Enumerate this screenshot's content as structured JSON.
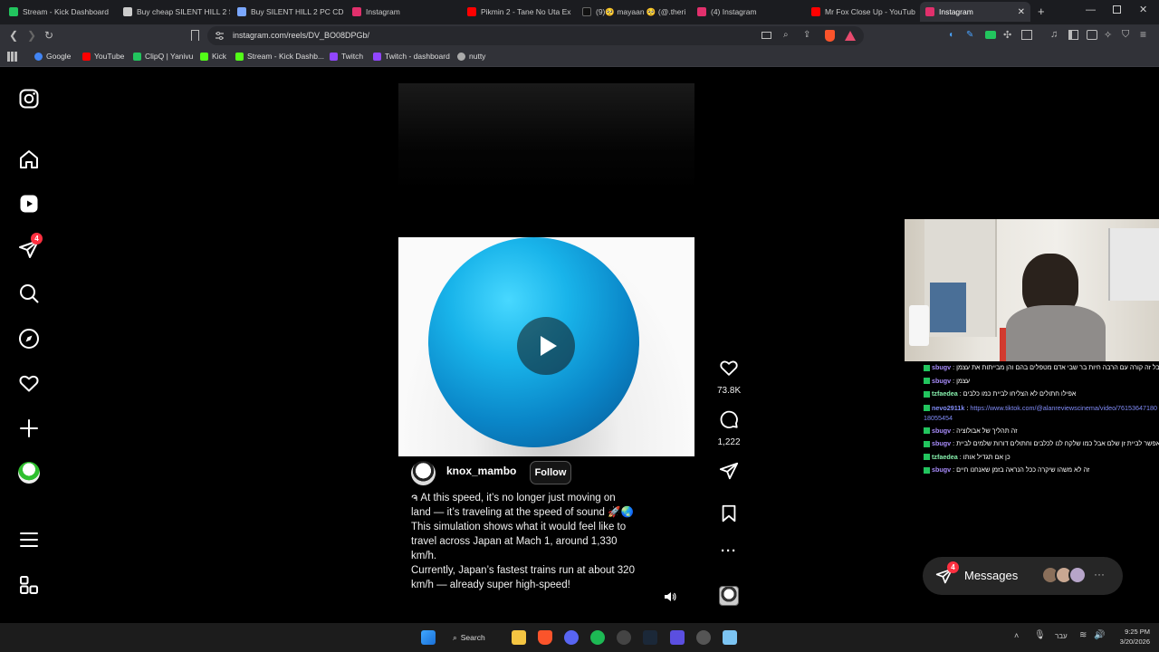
{
  "browser": {
    "tabs": [
      {
        "title": "Stream - Kick Dashboard",
        "fav": "#22c55e"
      },
      {
        "title": "Buy cheap SILENT HILL 2 S",
        "fav": "#cccccc"
      },
      {
        "title": "Buy SILENT HILL 2 PC CD K",
        "fav": "#7aa7ff"
      },
      {
        "title": "Instagram",
        "fav": "#e1306c"
      },
      {
        "title": "Pikmin 2 - Tane No Uta Ex",
        "fav": "#ff0000"
      },
      {
        "title": "(9)🥺 mayaan 🥺 (@.theri",
        "fav": "#111111"
      },
      {
        "title": "(4) Instagram",
        "fav": "#e1306c"
      },
      {
        "title": "Mr Fox Close Up - YouTub",
        "fav": "#ff0000"
      },
      {
        "title": "Instagram",
        "fav": "#e1306c"
      }
    ],
    "url": "instagram.com/reels/DV_BO08DPGb/",
    "bookmarks": [
      {
        "label": "Google",
        "color": "#4285f4"
      },
      {
        "label": "YouTube",
        "color": "#ff0000"
      },
      {
        "label": "ClipQ | Yanivu",
        "color": "#22c55e"
      },
      {
        "label": "Kick",
        "color": "#53fc18"
      },
      {
        "label": "Stream - Kick Dashb...",
        "color": "#53fc18"
      },
      {
        "label": "Twitch",
        "color": "#9146ff"
      },
      {
        "label": "Twitch - dashboard",
        "color": "#9146ff"
      },
      {
        "label": "nutty",
        "color": "#aaaaaa"
      }
    ]
  },
  "sidebar": {
    "notifications_badge": "4"
  },
  "reel": {
    "username": "knox_mambo",
    "follow_label": "Follow",
    "caption": "ຈ At this speed, it’s no longer just moving on land — it’s traveling at the speed of sound 🚀🌏\nThis simulation shows what it would feel like to travel across Japan at Mach 1, around 1,330 km/h.\nCurrently, Japan’s fastest trains run at about 320 km/h — already super high-speed!",
    "likes": "73.8K",
    "comments": "1,222"
  },
  "chat": {
    "lines": [
      {
        "user": "sbugv",
        "color": "#a78bfa",
        "msg": "אבל זה קורה עם הרבה חיות בר שבי אדם מטפלים בהם והן מבייתות את עצמן"
      },
      {
        "user": "sbugv",
        "color": "#a78bfa",
        "msg": "עצמן"
      },
      {
        "user": "tzfaedea",
        "color": "#86efac",
        "msg": "אפילו חתולים לא הצליחו לביית כמו כלבים"
      },
      {
        "user": "nevo2911k",
        "color": "#818cf8",
        "msg": "https://www.tiktok.com/@alanreviewscinema/video/7615364718018055454"
      },
      {
        "user": "sbugv",
        "color": "#a78bfa",
        "msg": "זה תהליך של אבולוציה"
      },
      {
        "user": "sbugv",
        "color": "#a78bfa",
        "msg": "אפשר לביית זן שלם אבל כמו שלקח לנו לכלבים וחתולים דורות שלמים לביית"
      },
      {
        "user": "tzfaedea",
        "color": "#86efac",
        "msg": "כן אם תגדיל אותו"
      },
      {
        "user": "sbugv",
        "color": "#a78bfa",
        "msg": "זה לא משהו שיקרה ככל הנראה בזמן שאנחנו חיים"
      }
    ]
  },
  "messages": {
    "label": "Messages",
    "badge": "4"
  },
  "taskbar": {
    "search_label": "Search",
    "lang": "עבר",
    "time": "9:25 PM",
    "date": "3/20/2026"
  }
}
